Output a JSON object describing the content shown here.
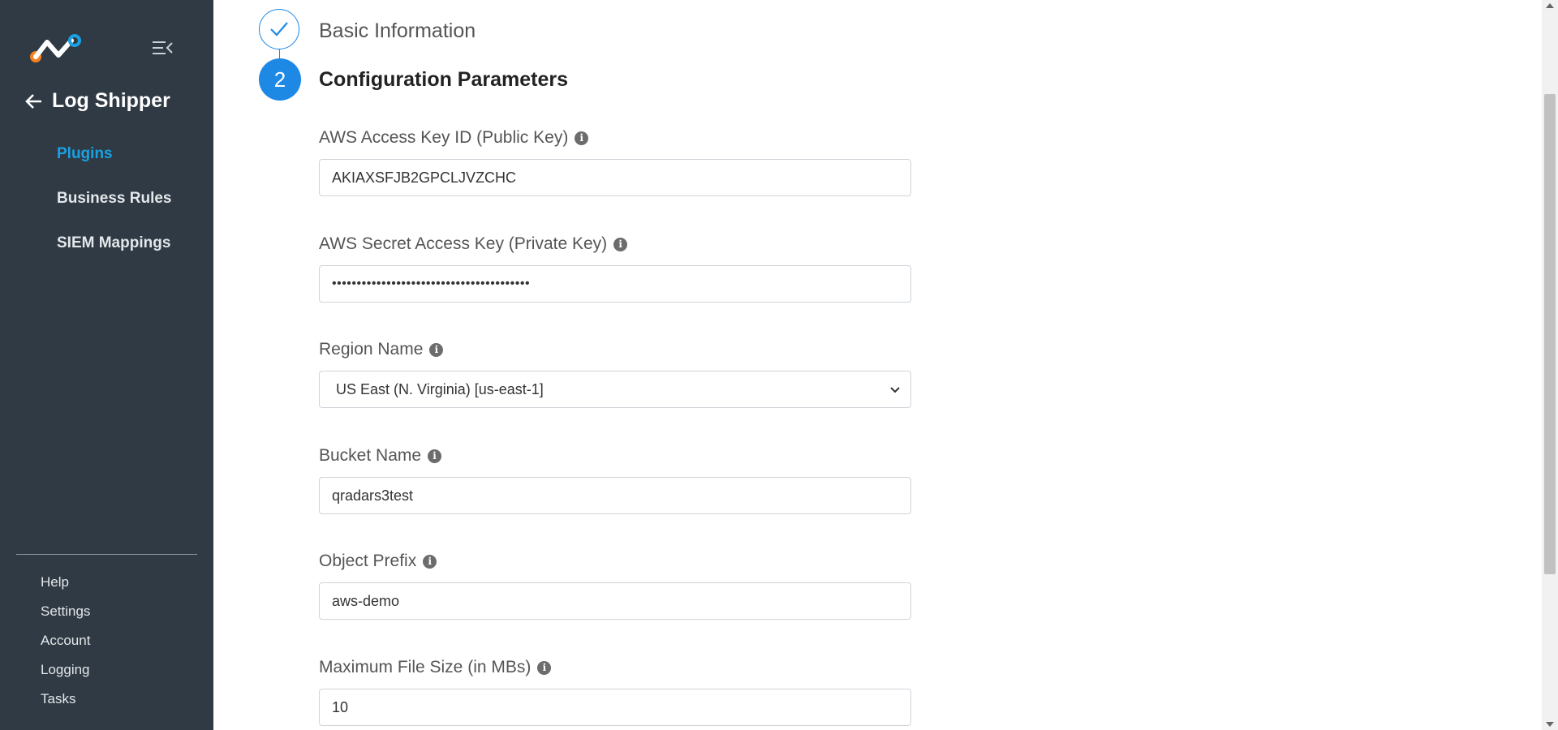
{
  "sidebar": {
    "back_title": "Log Shipper",
    "nav_items": [
      {
        "label": "Plugins",
        "active": true
      },
      {
        "label": "Business Rules",
        "active": false
      },
      {
        "label": "SIEM Mappings",
        "active": false
      }
    ],
    "footer_items": [
      "Help",
      "Settings",
      "Account",
      "Logging",
      "Tasks"
    ]
  },
  "steps": {
    "done_title": "Basic Information",
    "active_number": "2",
    "active_title": "Configuration Parameters"
  },
  "fields": {
    "access_key": {
      "label": "AWS Access Key ID (Public Key)",
      "value": "AKIAXSFJB2GPCLJVZCHC"
    },
    "secret_key": {
      "label": "AWS Secret Access Key (Private Key)",
      "value": "••••••••••••••••••••••••••••••••••••••••"
    },
    "region": {
      "label": "Region Name",
      "value": "US East (N. Virginia) [us-east-1]"
    },
    "bucket": {
      "label": "Bucket Name",
      "value": "qradars3test"
    },
    "prefix": {
      "label": "Object Prefix",
      "value": "aws-demo"
    },
    "max_size": {
      "label": "Maximum File Size (in MBs)",
      "value": "10"
    }
  },
  "info_glyph": "i",
  "colors": {
    "sidebar_bg": "#2f3a44",
    "accent": "#1e88e5",
    "active_nav": "#1aa1e3"
  }
}
